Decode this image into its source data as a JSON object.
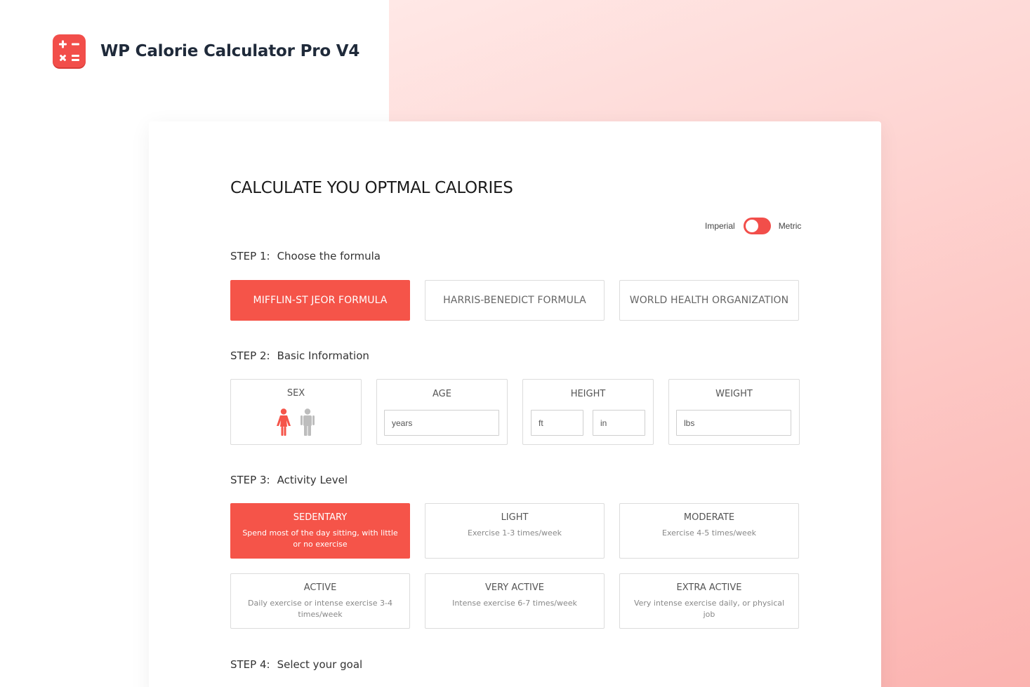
{
  "brand": {
    "title": "WP Calorie Calculator Pro V4",
    "logo_icon": "calculator-icon"
  },
  "colors": {
    "accent": "#f55449",
    "accent_dark": "#f24e4a",
    "inactive_icon": "#bdbdbd"
  },
  "calculator": {
    "heading": "CALCULATE YOU OPTMAL CALORIES",
    "units": {
      "imperial": "Imperial",
      "metric": "Metric",
      "selected": "Imperial"
    },
    "step1": {
      "num": "STEP 1:",
      "label": "Choose the formula"
    },
    "formulas": [
      {
        "label": "MIFFLIN-ST JEOR FORMULA",
        "active": true
      },
      {
        "label": "HARRIS-BENEDICT FORMULA",
        "active": false
      },
      {
        "label": "WORLD HEALTH ORGANIZATION",
        "active": false
      }
    ],
    "step2": {
      "num": "STEP 2:",
      "label": "Basic Information"
    },
    "basic": {
      "sex": {
        "label": "SEX",
        "selected": "female"
      },
      "age": {
        "label": "AGE",
        "placeholder": "years"
      },
      "height": {
        "label": "HEIGHT",
        "ft_placeholder": "ft",
        "in_placeholder": "in"
      },
      "weight": {
        "label": "WEIGHT",
        "placeholder": "lbs"
      }
    },
    "step3": {
      "num": "STEP 3:",
      "label": "Activity Level"
    },
    "activities": [
      {
        "title": "SEDENTARY",
        "desc": "Spend most of the day sitting, with little or no exercise",
        "active": true
      },
      {
        "title": "LIGHT",
        "desc": "Exercise 1-3 times/week",
        "active": false
      },
      {
        "title": "MODERATE",
        "desc": "Exercise 4-5 times/week",
        "active": false
      },
      {
        "title": "ACTIVE",
        "desc": "Daily exercise or intense exercise 3-4 times/week",
        "active": false
      },
      {
        "title": "VERY ACTIVE",
        "desc": "Intense exercise 6-7 times/week",
        "active": false
      },
      {
        "title": "EXTRA ACTIVE",
        "desc": "Very intense exercise daily, or physical job",
        "active": false
      }
    ],
    "step4": {
      "num": "STEP 4:",
      "label": "Select your goal"
    }
  }
}
